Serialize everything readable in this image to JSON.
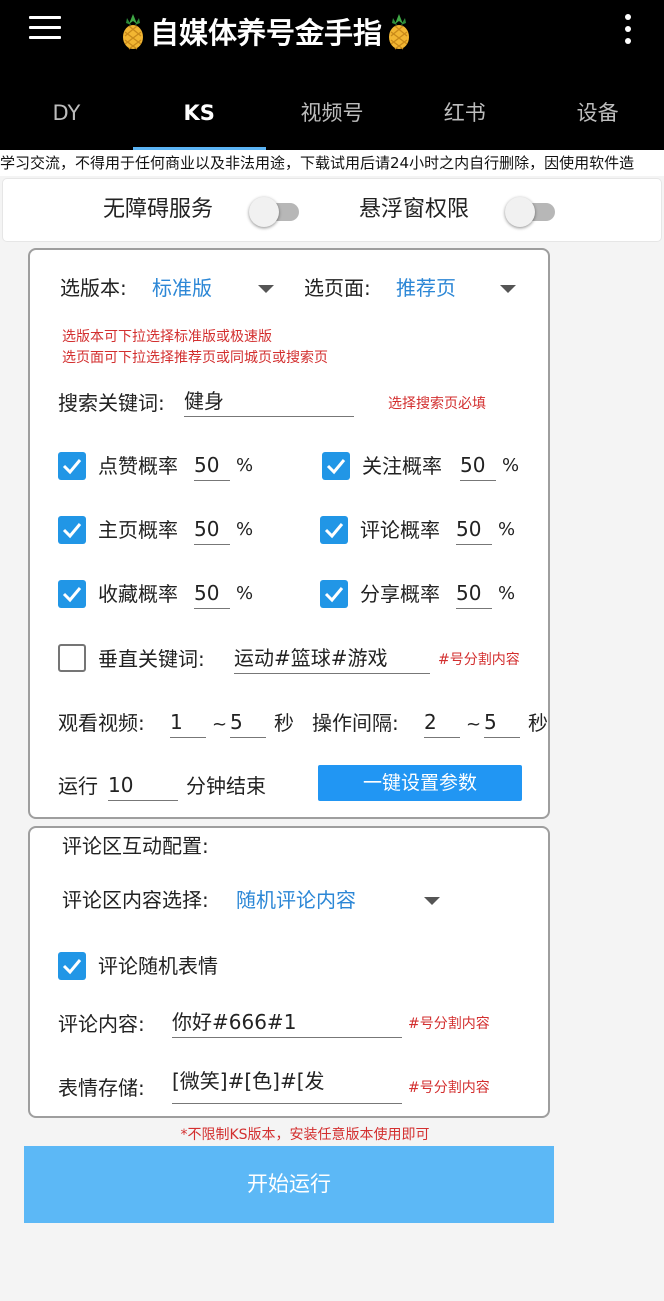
{
  "app": {
    "title": "自媒体养号金手指",
    "title_icon": "pineapple-icon"
  },
  "tabs": [
    {
      "label": "DY",
      "active": false
    },
    {
      "label": "KS",
      "active": true
    },
    {
      "label": "视频号",
      "active": false
    },
    {
      "label": "红书",
      "active": false
    },
    {
      "label": "设备",
      "active": false
    }
  ],
  "notice": "学习交流，不得用于任何商业以及非法用途，下载试用后请24小时之内自行删除，因使用软件造",
  "permissions": {
    "accessibility_label": "无障碍服务",
    "accessibility_on": false,
    "overlay_label": "悬浮窗权限",
    "overlay_on": false
  },
  "settings": {
    "version_label": "选版本:",
    "version_value": "标准版",
    "page_label": "选页面:",
    "page_value": "推荐页",
    "hint_line1": "选版本可下拉选择标准版或极速版",
    "hint_line2": "选页面可下拉选择推荐页或同城页或搜索页",
    "keyword_label": "搜索关键词:",
    "keyword_value": "健身",
    "keyword_hint": "选择搜索页必填",
    "rates": {
      "like": {
        "label": "点赞概率",
        "value": "50",
        "unit": "%",
        "checked": true
      },
      "follow": {
        "label": "关注概率",
        "value": "50",
        "unit": "%",
        "checked": true
      },
      "homepage": {
        "label": "主页概率",
        "value": "50",
        "unit": "%",
        "checked": true
      },
      "comment": {
        "label": "评论概率",
        "value": "50",
        "unit": "%",
        "checked": true
      },
      "favorite": {
        "label": "收藏概率",
        "value": "50",
        "unit": "%",
        "checked": true
      },
      "share": {
        "label": "分享概率",
        "value": "50",
        "unit": "%",
        "checked": true
      }
    },
    "vertical": {
      "label": "垂直关键词:",
      "value": "运动#篮球#游戏",
      "hint": "#号分割内容",
      "checked": false
    },
    "watch_label": "观看视频:",
    "watch_min": "1",
    "watch_sep": "~",
    "watch_max": "5",
    "watch_unit": "秒",
    "interval_label": "操作间隔:",
    "interval_min": "2",
    "interval_sep": "~",
    "interval_max": "5",
    "interval_unit": "秒",
    "run_label": "运行",
    "run_value": "10",
    "run_suffix": "分钟结束",
    "setup_button": "一键设置参数"
  },
  "comments": {
    "title": "评论区互动配置:",
    "content_select_label": "评论区内容选择:",
    "content_select_value": "随机评论内容",
    "random_emoji_label": "评论随机表情",
    "random_emoji_checked": true,
    "content_label": "评论内容:",
    "content_value": "你好#666#1",
    "content_hint": "#号分割内容",
    "emoji_label": "表情存储:",
    "emoji_value": "[微笑]#[色]#[发",
    "emoji_hint": "#号分割内容"
  },
  "footnote": "*不限制KS版本，安装任意版本使用即可",
  "start_button": "开始运行",
  "colors": {
    "accent": "#2196f3",
    "start_button": "#5cb8f6",
    "hint_red": "#d32f2f",
    "select_blue": "#2c87d6",
    "topbar": "#000000"
  }
}
